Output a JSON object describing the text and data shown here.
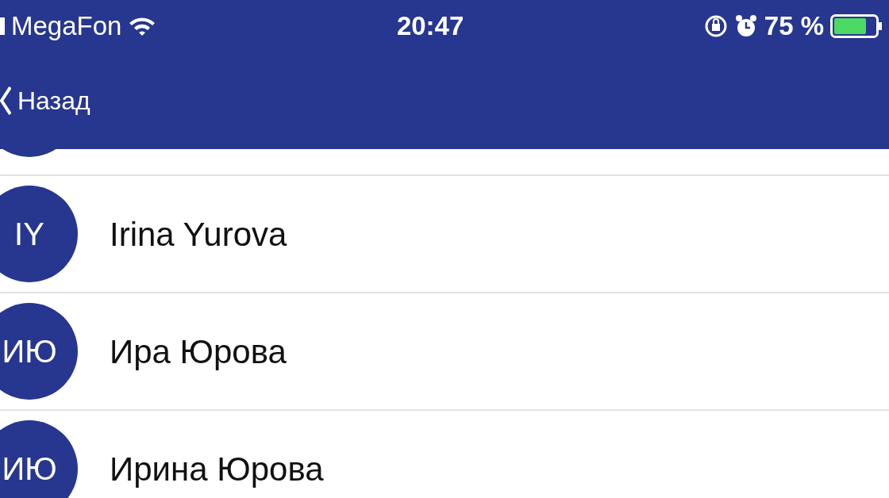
{
  "status_bar": {
    "carrier": "MegaFon",
    "time": "20:47",
    "battery": "75 %"
  },
  "nav_bar": {
    "back": "Назад"
  },
  "contacts": [
    {
      "kind": "scrolled"
    },
    {
      "kind": "contact",
      "initials": "IY",
      "name": "Irina Yurova"
    },
    {
      "kind": "contact",
      "initials": "ИЮ",
      "name": "Ира Юрова"
    },
    {
      "kind": "contact",
      "initials": "ИЮ",
      "name": "Ирина Юрова"
    }
  ]
}
